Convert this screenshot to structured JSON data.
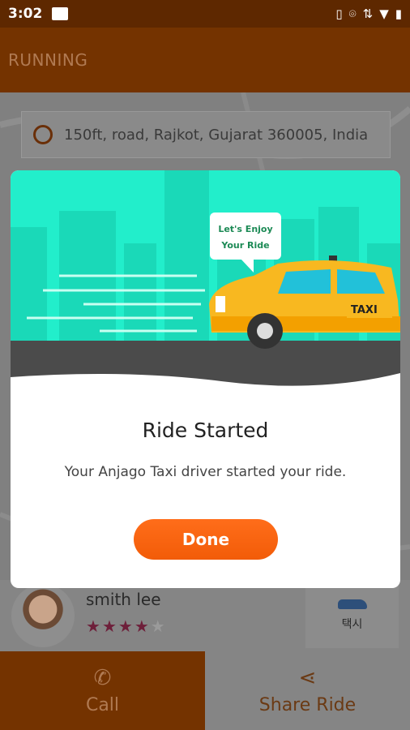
{
  "status_bar": {
    "time": "3:02"
  },
  "app_bar": {
    "title": "RUNNING"
  },
  "address": {
    "text": "150ft, road, Rajkot, Gujarat 360005, India"
  },
  "driver": {
    "name": "smith lee",
    "rating": 4,
    "rating_max": 5,
    "vehicle_label": "택시"
  },
  "bottom_actions": {
    "call_label": "Call",
    "share_label": "Share Ride"
  },
  "dialog": {
    "title": "Ride Started",
    "message": "Your Anjago Taxi driver started your ride.",
    "done_label": "Done",
    "bubble_line1": "Let's Enjoy",
    "bubble_line2": "Your Ride",
    "taxi_sign": "TAXI"
  },
  "colors": {
    "app_bar": "#743300",
    "accent": "#f25c08",
    "illustration_bg": "#22eecb"
  }
}
